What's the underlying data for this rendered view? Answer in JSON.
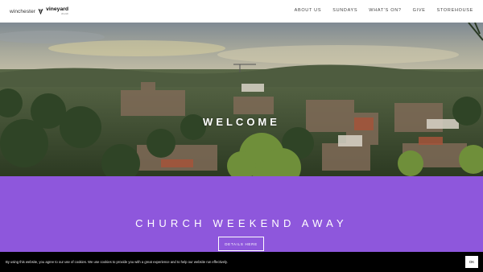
{
  "header": {
    "logo_city": "winchester",
    "logo_brand": "vineyard",
    "logo_sub": "church",
    "nav": [
      "ABOUT US",
      "SUNDAYS",
      "WHAT'S ON?",
      "GIVE",
      "STOREHOUSE"
    ]
  },
  "hero": {
    "title": "WELCOME"
  },
  "promo": {
    "title": "CHURCH WEEKEND AWAY",
    "button_label": "DETAILS HERE",
    "background": "#8e57dc"
  },
  "cookie": {
    "text": "By using this website, you agree to our use of cookies. We use cookies to provide you with a great experience and to help our website run effectively.",
    "button_label": "OK"
  }
}
